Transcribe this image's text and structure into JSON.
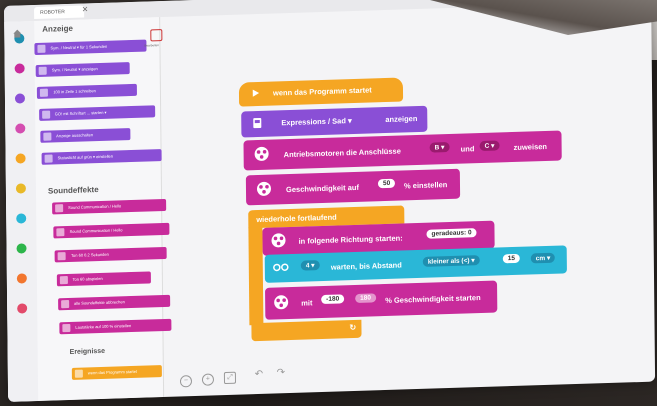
{
  "browser": {
    "tab_label": "ROBOTER",
    "close_glyph": "×"
  },
  "palette": {
    "section1_title": "Anzeige",
    "section2_title": "Soundeffekte",
    "section3_title": "Ereignisse",
    "edit_label": "Bearbeiten",
    "blocks_anzeige": [
      "Sym. / Neutral ▾ für 1 Sekunden",
      "Sym. / Neutral ▾ anzeigen",
      "100 in Zeile 1 schreiben",
      "GO! mit Schriftart ... starten ▾",
      "Anzeige ausschalten",
      "Statuslicht auf grün ▾ einstellen"
    ],
    "blocks_sound": [
      "Sound Communication / Hello",
      "Sound Communication / Hello",
      "Ton 60 0.2 Sekunden",
      "Ton 60 abspielen",
      "alle Soundeffekte abbrechen",
      "Lautstärke auf 100 % einstellen"
    ],
    "blocks_events": [
      "wenn das Programm startet"
    ]
  },
  "script": {
    "hat_label": "wenn das Programm startet",
    "display_value": "Expressions / Sad",
    "display_suffix": "anzeigen",
    "assign_label": "Antriebsmotoren die Anschlüsse",
    "port_a": "B",
    "port_conj": "und",
    "port_b": "C",
    "assign_suffix": "zuweisen",
    "speed_label": "Geschwindigkeit auf",
    "speed_value": "50",
    "speed_suffix": "% einstellen",
    "loop_label": "wiederhole fortlaufend",
    "steer_label": "in folgende Richtung starten:",
    "steer_value": "geradeaus: 0",
    "wait_port": "4",
    "wait_label": "warten, bis Abstand",
    "wait_compare": "kleiner als (<)",
    "wait_value": "15",
    "wait_unit": "cm",
    "mit_label": "mit",
    "mit_value1": "-180",
    "mit_value2": "180",
    "mit_suffix": "% Geschwindigkeit starten"
  }
}
